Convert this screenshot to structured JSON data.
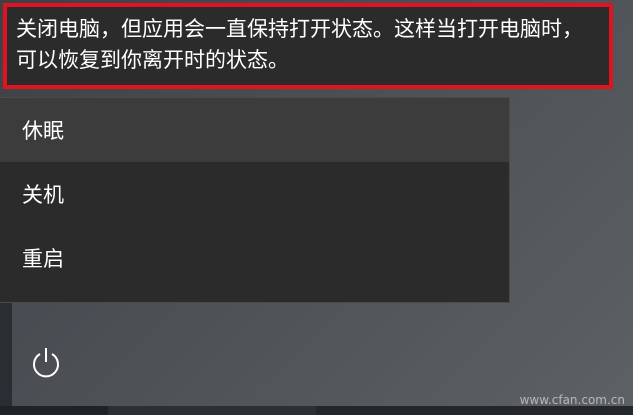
{
  "tooltip": {
    "text": "关闭电脑，但应用会一直保持打开状态。这样当打开电脑时，可以恢复到你离开时的状态。"
  },
  "power_menu": {
    "items": [
      {
        "label": "休眠",
        "hover": true
      },
      {
        "label": "关机",
        "hover": false
      },
      {
        "label": "重启",
        "hover": false
      }
    ]
  },
  "power_button": {
    "icon": "power-icon"
  },
  "watermark": {
    "text": "www.cfan.com.cn"
  },
  "colors": {
    "highlight_border": "#e0141e",
    "menu_background": "#2b2b2b",
    "menu_hover": "#3c3c3c"
  }
}
